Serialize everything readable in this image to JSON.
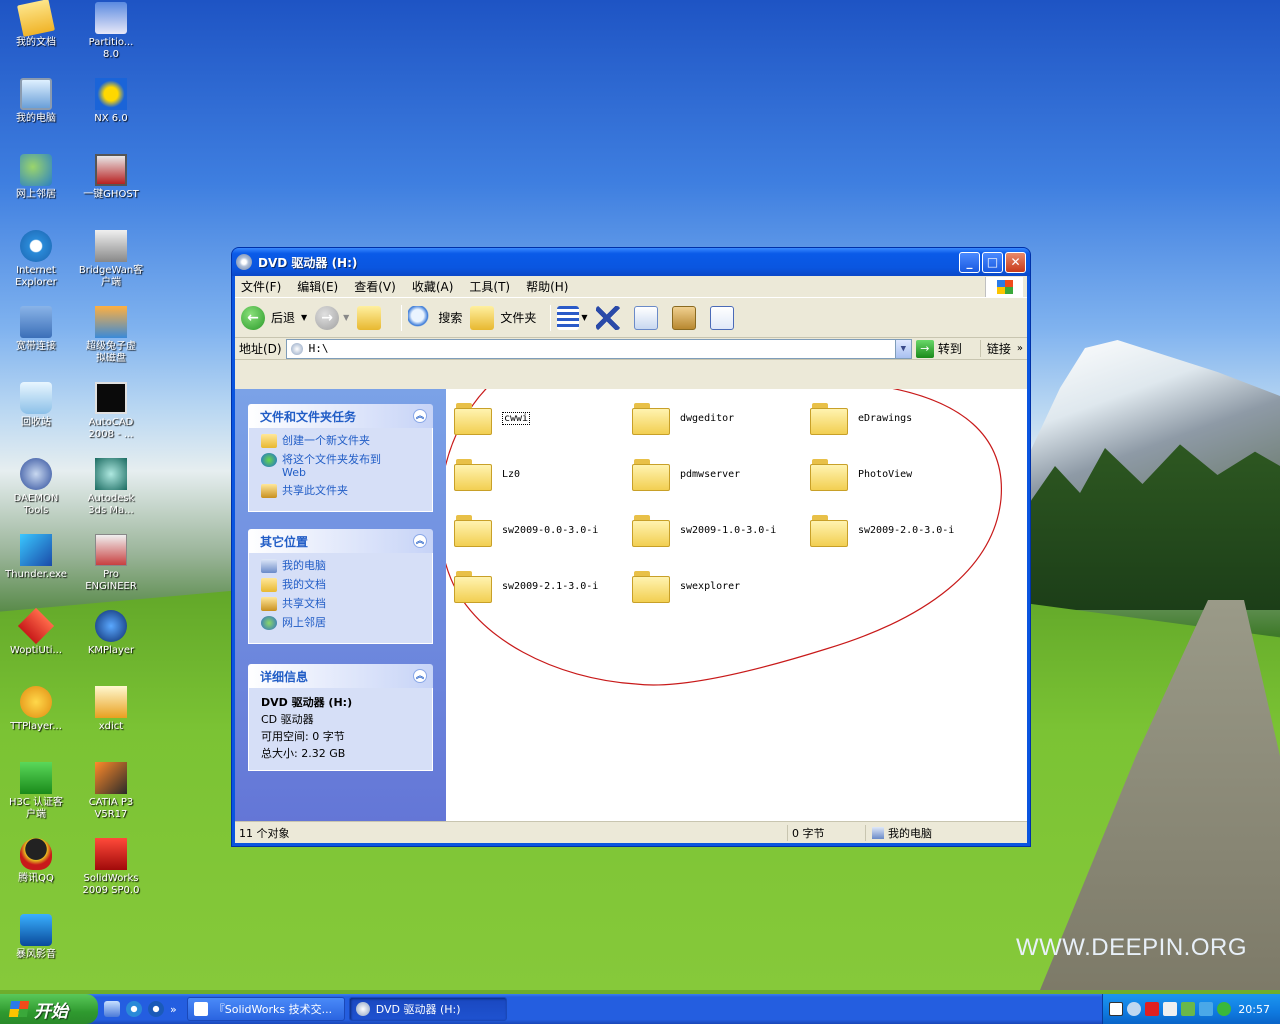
{
  "desktop": {
    "watermark": "WWW.DEEPIN.ORG",
    "icons_col1": [
      {
        "label": "我的文档",
        "icon": "my-documents-icon",
        "cls": "ic-doc"
      },
      {
        "label": "我的电脑",
        "icon": "my-computer-icon",
        "cls": "ic-pc"
      },
      {
        "label": "网上邻居",
        "icon": "network-places-icon",
        "cls": "ic-net"
      },
      {
        "label": "Internet\nExplorer",
        "icon": "internet-explorer-icon",
        "cls": "ic-ie"
      },
      {
        "label": "宽带连接",
        "icon": "broadband-connection-icon",
        "cls": "ic-bb"
      },
      {
        "label": "回收站",
        "icon": "recycle-bin-icon",
        "cls": "ic-bin"
      },
      {
        "label": "DAEMON\nTools",
        "icon": "daemon-tools-icon",
        "cls": "ic-dt"
      },
      {
        "label": "Thunder.exe",
        "icon": "thunder-icon",
        "cls": "ic-thu"
      },
      {
        "label": "WoptiUti...",
        "icon": "woptiuti-icon",
        "cls": "ic-wo"
      },
      {
        "label": "TTPlayer...",
        "icon": "ttplayer-icon",
        "cls": "ic-ttp"
      },
      {
        "label": "H3C 认证客\n户端",
        "icon": "h3c-client-icon",
        "cls": "ic-h3c"
      },
      {
        "label": "腾讯QQ",
        "icon": "qq-icon",
        "cls": "ic-qq"
      },
      {
        "label": "暴风影音",
        "icon": "baofeng-icon",
        "cls": "ic-bf"
      }
    ],
    "icons_col2": [
      {
        "label": "Partitio...\n8.0",
        "icon": "partition-magic-icon",
        "cls": "ic-pt"
      },
      {
        "label": "NX 6.0",
        "icon": "nx-icon",
        "cls": "ic-nx"
      },
      {
        "label": "一键GHOST",
        "icon": "ghost-icon",
        "cls": "ic-gh"
      },
      {
        "label": "BridgeWan客\n户端",
        "icon": "bridgewan-icon",
        "cls": "ic-bw"
      },
      {
        "label": "超级兔子虚\n拟磁盘",
        "icon": "super-rabbit-icon",
        "cls": "ic-cj"
      },
      {
        "label": "AutoCAD\n2008 - ...",
        "icon": "autocad-icon",
        "cls": "ic-ac"
      },
      {
        "label": "Autodesk\n3ds Ma...",
        "icon": "3ds-max-icon",
        "cls": "ic-3ds"
      },
      {
        "label": "Pro\nENGINEER",
        "icon": "pro-engineer-icon",
        "cls": "ic-pro"
      },
      {
        "label": "KMPlayer",
        "icon": "kmplayer-icon",
        "cls": "ic-kmp"
      },
      {
        "label": "xdict",
        "icon": "xdict-icon",
        "cls": "ic-xd"
      },
      {
        "label": "CATIA P3\nV5R17",
        "icon": "catia-icon",
        "cls": "ic-cat"
      },
      {
        "label": "SolidWorks\n2009 SP0.0",
        "icon": "solidworks-icon",
        "cls": "ic-sw"
      }
    ]
  },
  "window": {
    "title": "DVD 驱动器 (H:)",
    "menu": [
      "文件(F)",
      "编辑(E)",
      "查看(V)",
      "收藏(A)",
      "工具(T)",
      "帮助(H)"
    ],
    "toolbar": {
      "back": "后退",
      "search": "搜索",
      "folders": "文件夹"
    },
    "address": {
      "label": "地址(D)",
      "value": "H:\\",
      "go": "转到",
      "links": "链接"
    },
    "tasks": {
      "title": "文件和文件夹任务",
      "links": [
        {
          "label": "创建一个新文件夹",
          "icon": "new-folder-icon",
          "cls": "pi-folder"
        },
        {
          "label": "将这个文件夹发布到\nWeb",
          "icon": "publish-web-icon",
          "cls": "pi-web"
        },
        {
          "label": "共享此文件夹",
          "icon": "share-folder-icon",
          "cls": "pi-share"
        }
      ]
    },
    "other_places": {
      "title": "其它位置",
      "links": [
        {
          "label": "我的电脑",
          "icon": "my-computer-icon",
          "cls": "pi-pc"
        },
        {
          "label": "我的文档",
          "icon": "my-documents-icon",
          "cls": "pi-folder"
        },
        {
          "label": "共享文档",
          "icon": "shared-documents-icon",
          "cls": "pi-share"
        },
        {
          "label": "网上邻居",
          "icon": "network-places-icon",
          "cls": "pi-net"
        }
      ]
    },
    "details": {
      "title": "详细信息",
      "name": "DVD 驱动器 (H:)",
      "type": "CD 驱动器",
      "free": "可用空间: 0 字节",
      "total": "总大小: 2.32 GB"
    },
    "files": [
      "cwwi",
      "dwgeditor",
      "eDrawings",
      "Lz0",
      "pdmwserver",
      "PhotoView",
      "sw2009-0.0-3.0-i",
      "sw2009-1.0-3.0-i",
      "sw2009-2.0-3.0-i",
      "sw2009-2.1-3.0-i",
      "swexplorer"
    ],
    "status": {
      "count": "11 个对象",
      "size": "0 字节",
      "location": "我的电脑"
    }
  },
  "taskbar": {
    "start": "开始",
    "tasks": [
      "『SolidWorks 技术交...",
      "DVD 驱动器 (H:)"
    ],
    "clock": "20:57"
  }
}
